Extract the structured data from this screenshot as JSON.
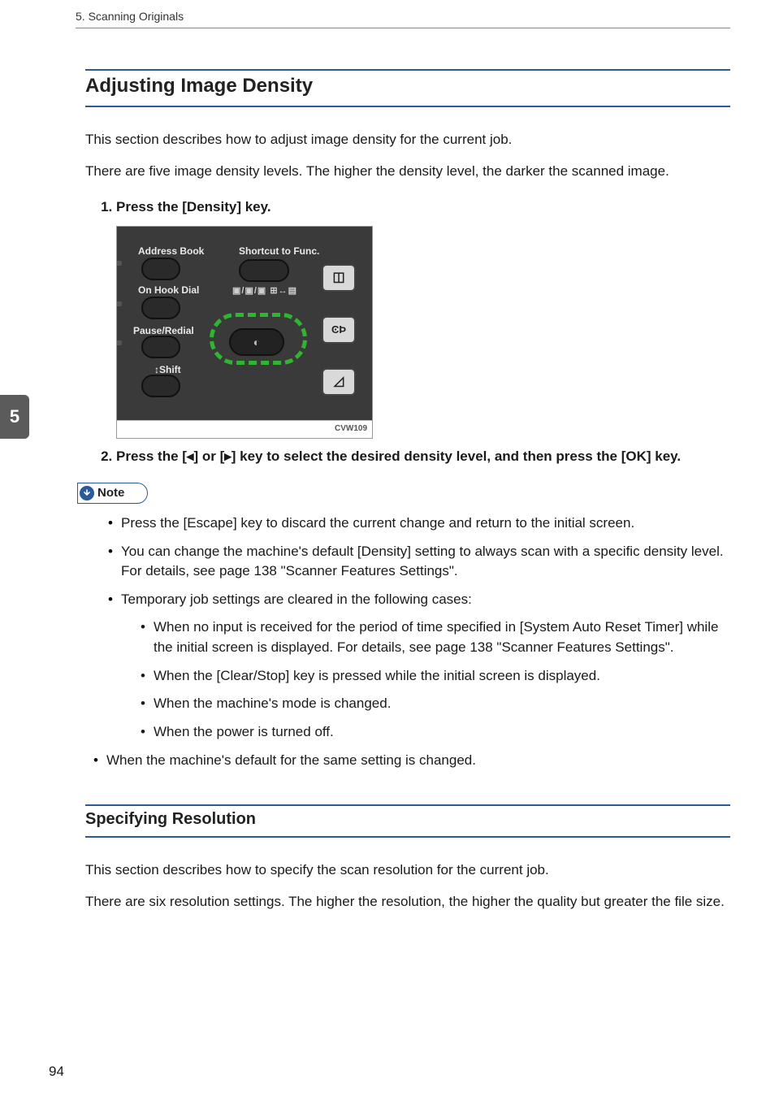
{
  "running_head": "5. Scanning Originals",
  "chapter_tab": "5",
  "section": {
    "title": "Adjusting Image Density",
    "intro": [
      "This section describes how to adjust image density for the current job.",
      "There are five image density levels. The higher the density level, the darker the scanned image."
    ],
    "steps": [
      "Press the [Density] key.",
      "Press the [◂] or [▸] key to select the desired density level, and then press the [OK] key."
    ],
    "figure": {
      "labels": {
        "address_book": "Address Book",
        "shortcut": "Shortcut to Func.",
        "on_hook": "On Hook Dial",
        "pause_redial": "Pause/Redial",
        "shift": "Shift",
        "icons_row": "▣/▣/▣ ⊞↔▤"
      },
      "sqbtn_icons": {
        "mode": "◫",
        "cp": "ϾϷ",
        "clear": "◿"
      },
      "caption": "CVW109"
    },
    "note_label": "Note",
    "notes": [
      "Press the [Escape] key to discard the current change and return to the initial screen.",
      "You can change the machine's default [Density] setting to always scan with a specific density level. For details, see page 138 \"Scanner Features Settings\".",
      "Temporary job settings are cleared in the following cases:"
    ],
    "subnotes": [
      "When no input is received for the period of time specified in [System Auto Reset Timer] while the initial screen is displayed. For details, see page 138 \"Scanner Features Settings\".",
      "When the [Clear/Stop] key is pressed while the initial screen is displayed.",
      "When the machine's mode is changed.",
      "When the power is turned off."
    ],
    "tail_note": "When the machine's default for the same setting is changed."
  },
  "subsection": {
    "title": "Specifying Resolution",
    "paras": [
      "This section describes how to specify the scan resolution for the current job.",
      "There are six resolution settings. The higher the resolution, the higher the quality but greater the file size."
    ]
  },
  "page_number": "94"
}
